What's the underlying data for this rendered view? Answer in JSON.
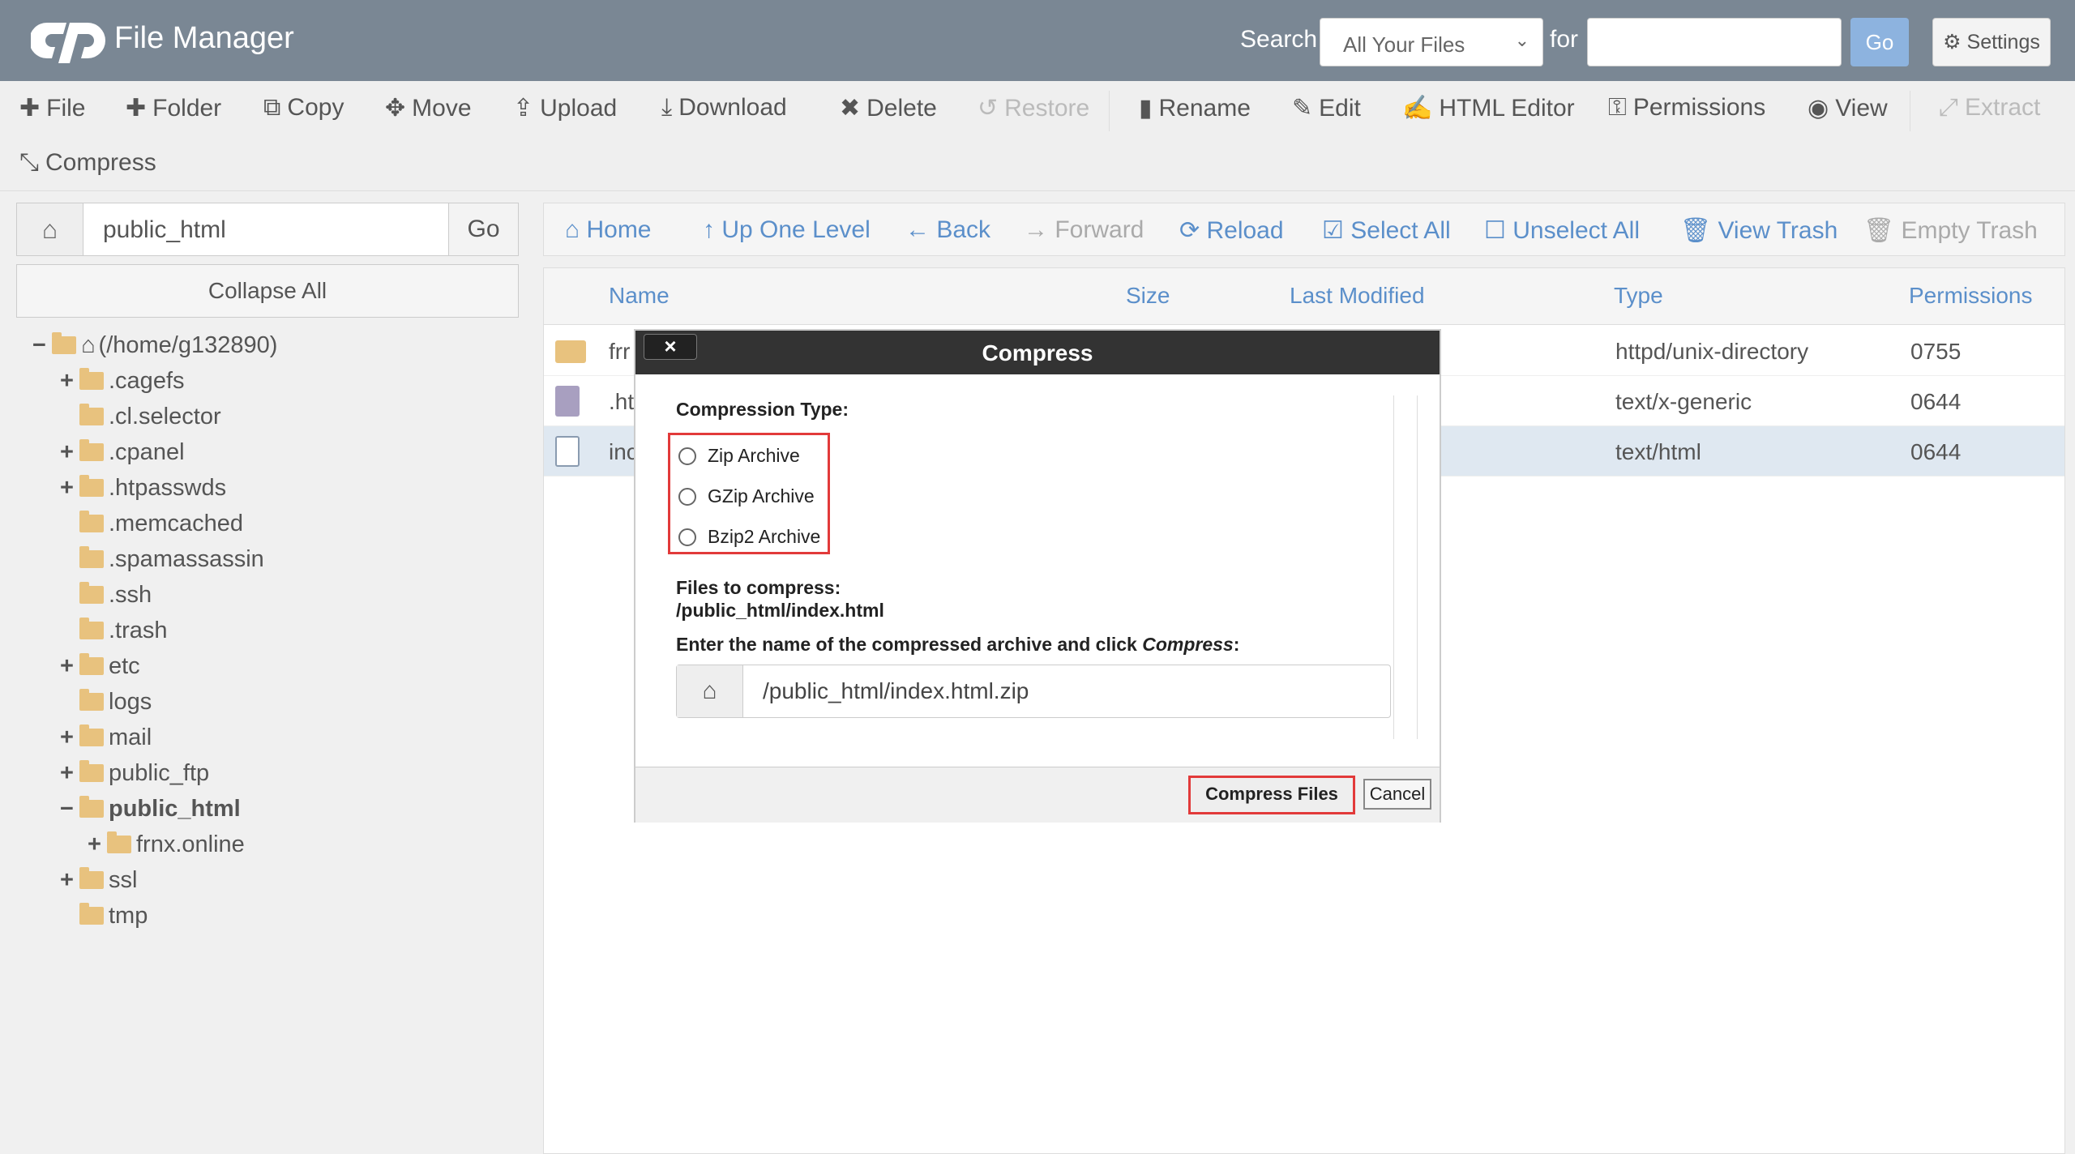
{
  "header": {
    "title": "File Manager",
    "search_label": "Search",
    "search_scope": "All Your Files",
    "for_label": "for",
    "search_value": "",
    "go_label": "Go",
    "settings_label": "Settings"
  },
  "toolbar": {
    "items": [
      {
        "label": "File",
        "icon": "plus-icon",
        "enabled": true
      },
      {
        "label": "Folder",
        "icon": "plus-icon",
        "enabled": true
      },
      {
        "label": "Copy",
        "icon": "copy-icon",
        "enabled": true
      },
      {
        "label": "Move",
        "icon": "move-icon",
        "enabled": true
      },
      {
        "label": "Upload",
        "icon": "upload-icon",
        "enabled": true
      },
      {
        "label": "Download",
        "icon": "download-icon",
        "enabled": true
      },
      {
        "label": "Delete",
        "icon": "delete-icon",
        "enabled": true
      },
      {
        "label": "Restore",
        "icon": "restore-icon",
        "enabled": false
      },
      {
        "label": "Rename",
        "icon": "file-icon",
        "enabled": true
      },
      {
        "label": "Edit",
        "icon": "pencil-icon",
        "enabled": true
      },
      {
        "label": "HTML Editor",
        "icon": "edit-icon",
        "enabled": true
      },
      {
        "label": "Permissions",
        "icon": "key-icon",
        "enabled": true
      },
      {
        "label": "View",
        "icon": "eye-icon",
        "enabled": true
      },
      {
        "label": "Extract",
        "icon": "expand-icon",
        "enabled": false
      },
      {
        "label": "Compress",
        "icon": "compress-icon",
        "enabled": true
      }
    ]
  },
  "sidebar": {
    "path_value": "public_html",
    "go_label": "Go",
    "collapse_label": "Collapse All",
    "tree": [
      {
        "label": "(/home/g132890)",
        "toggle": "−",
        "level": 0
      },
      {
        "label": ".cagefs",
        "toggle": "+",
        "level": 1
      },
      {
        "label": ".cl.selector",
        "toggle": "",
        "level": 1
      },
      {
        "label": ".cpanel",
        "toggle": "+",
        "level": 1
      },
      {
        "label": ".htpasswds",
        "toggle": "+",
        "level": 1
      },
      {
        "label": ".memcached",
        "toggle": "",
        "level": 1
      },
      {
        "label": ".spamassassin",
        "toggle": "",
        "level": 1
      },
      {
        "label": ".ssh",
        "toggle": "",
        "level": 1
      },
      {
        "label": ".trash",
        "toggle": "",
        "level": 1
      },
      {
        "label": "etc",
        "toggle": "+",
        "level": 1
      },
      {
        "label": "logs",
        "toggle": "",
        "level": 1
      },
      {
        "label": "mail",
        "toggle": "+",
        "level": 1
      },
      {
        "label": "public_ftp",
        "toggle": "+",
        "level": 1
      },
      {
        "label": "public_html",
        "toggle": "−",
        "level": 1
      },
      {
        "label": "frnx.online",
        "toggle": "+",
        "level": 2
      },
      {
        "label": "ssl",
        "toggle": "+",
        "level": 1
      },
      {
        "label": "tmp",
        "toggle": "",
        "level": 1
      }
    ]
  },
  "nav": {
    "items": [
      {
        "label": "Home",
        "icon": "home-icon",
        "enabled": true
      },
      {
        "label": "Up One Level",
        "icon": "up-arrow-icon",
        "enabled": true
      },
      {
        "label": "Back",
        "icon": "left-arrow-icon",
        "enabled": true
      },
      {
        "label": "Forward",
        "icon": "right-arrow-icon",
        "enabled": false
      },
      {
        "label": "Reload",
        "icon": "reload-icon",
        "enabled": true
      },
      {
        "label": "Select All",
        "icon": "checkbox-checked-icon",
        "enabled": true
      },
      {
        "label": "Unselect All",
        "icon": "checkbox-empty-icon",
        "enabled": true
      },
      {
        "label": "View Trash",
        "icon": "trash-icon",
        "enabled": true
      },
      {
        "label": "Empty Trash",
        "icon": "trash-icon",
        "enabled": false
      }
    ]
  },
  "table": {
    "columns": [
      "Name",
      "Size",
      "Last Modified",
      "Type",
      "Permissions"
    ],
    "rows": [
      {
        "name": "frr",
        "type": "httpd/unix-directory",
        "perms": "0755",
        "icon": "folder-icon"
      },
      {
        "name": ".ht",
        "type": "text/x-generic",
        "perms": "0644",
        "icon": "text-file-icon"
      },
      {
        "name": "inc",
        "type": "text/html",
        "perms": "0644",
        "icon": "html-file-icon"
      }
    ]
  },
  "modal": {
    "title": "Compress",
    "close_label": "×",
    "compression_type_label": "Compression Type:",
    "options": [
      "Zip Archive",
      "GZip Archive",
      "Bzip2 Archive"
    ],
    "files_label": "Files to compress:",
    "files_value": "/public_html/index.html",
    "enter_name_prefix": "Enter the name of the compressed archive and click ",
    "enter_name_em": "Compress",
    "enter_name_suffix": ":",
    "archive_name": "/public_html/index.html.zip",
    "compress_button": "Compress Files",
    "cancel_button": "Cancel"
  },
  "colors": {
    "header_bg": "#7a8794",
    "link_blue": "#5b8fca",
    "highlight_red": "#e23a3a",
    "folder": "#e8c27e"
  }
}
